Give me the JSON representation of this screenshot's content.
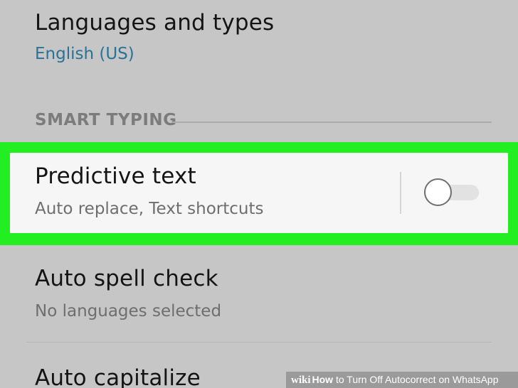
{
  "settings": {
    "languages": {
      "title": "Languages and types",
      "subtitle": "English (US)"
    },
    "section_header": "SMART TYPING",
    "predictive_text": {
      "title": "Predictive text",
      "subtitle": "Auto replace, Text shortcuts",
      "enabled": false
    },
    "auto_spell_check": {
      "title": "Auto spell check",
      "subtitle": "No languages selected"
    },
    "auto_capitalize": {
      "title": "Auto capitalize"
    }
  },
  "colors": {
    "background": "#c6c6c6",
    "highlight_border": "#22ee22",
    "highlight_fill": "#f6f6f6",
    "accent_text": "#2a7296"
  },
  "banner": {
    "brand": "wiki",
    "how": "How",
    "title_rest": " to Turn Off Autocorrect on WhatsApp"
  }
}
